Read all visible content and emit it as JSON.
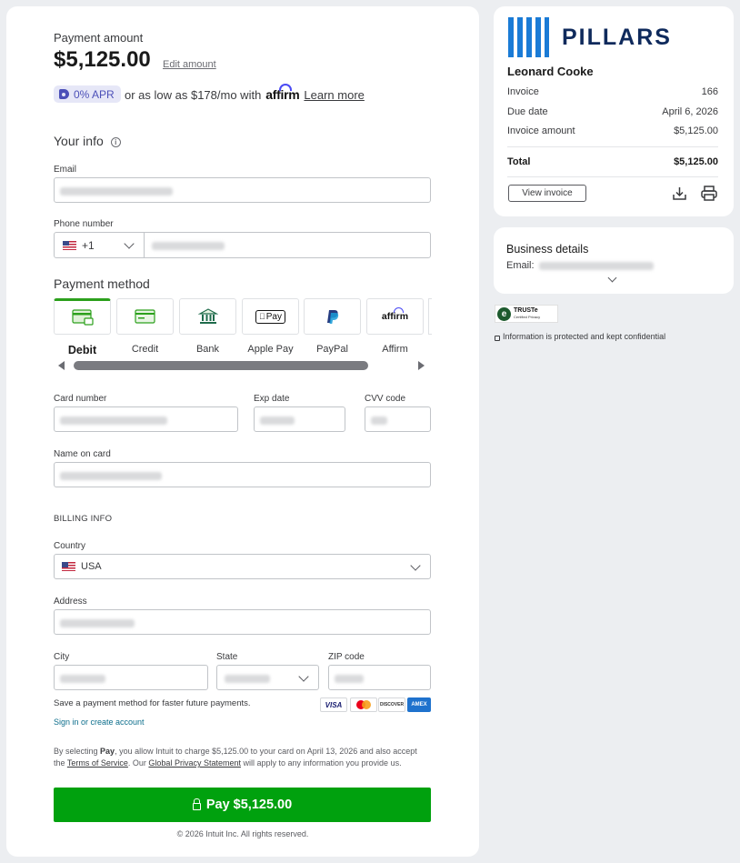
{
  "payment": {
    "label": "Payment amount",
    "amount": "$5,125.00",
    "edit_link": "Edit amount"
  },
  "financing": {
    "apr_badge": "0% APR",
    "text": "or as low as $178/mo with",
    "provider_logo": "affirm",
    "learn_more": "Learn more"
  },
  "your_info": {
    "title": "Your info",
    "email_label": "Email",
    "phone_label": "Phone number",
    "phone_country_code": "+1"
  },
  "payment_method": {
    "title": "Payment method",
    "tabs": [
      {
        "label": "Debit",
        "icon": "debit-card-icon",
        "active": true
      },
      {
        "label": "Credit",
        "icon": "credit-card-icon",
        "active": false
      },
      {
        "label": "Bank",
        "icon": "bank-icon",
        "active": false
      },
      {
        "label": "Apple Pay",
        "icon": "apple-pay-icon",
        "active": false
      },
      {
        "label": "PayPal",
        "icon": "paypal-icon",
        "active": false
      },
      {
        "label": "Affirm",
        "icon": "affirm-icon",
        "active": false
      }
    ],
    "apple_pay_mark": "Pay",
    "affirm_mark": "affirm"
  },
  "card_fields": {
    "card_number_label": "Card number",
    "exp_date_label": "Exp date",
    "cvv_label": "CVV code",
    "name_label": "Name on card"
  },
  "billing": {
    "title": "BILLING INFO",
    "country_label": "Country",
    "country_value": "USA",
    "address_label": "Address",
    "city_label": "City",
    "state_label": "State",
    "zip_label": "ZIP code"
  },
  "save_method_text": "Save a payment method for faster future payments.",
  "card_brands": [
    "VISA",
    "Mastercard",
    "DISCOVER",
    "AMEX"
  ],
  "signin_link": "Sign in or create account",
  "legal": {
    "prefix": "By selecting",
    "pay_word": "Pay",
    "middle": ", you allow Intuit to charge $5,125.00 to your card on April 13, 2026 and also accept the",
    "terms_link": "Terms of Service",
    "our": ". Our",
    "privacy_link": "Global Privacy Statement",
    "suffix": "will apply to any information you provide us."
  },
  "pay_button": "Pay $5,125.00",
  "footer": "© 2026 Intuit Inc. All rights reserved.",
  "invoice": {
    "company_logo": "PILLARS",
    "customer_name": "Leonard Cooke",
    "rows": [
      {
        "label": "Invoice",
        "value": "166"
      },
      {
        "label": "Due date",
        "value": "April 6, 2026"
      },
      {
        "label": "Invoice amount",
        "value": "$5,125.00"
      }
    ],
    "total_label": "Total",
    "total_value": "$5,125.00",
    "view_invoice": "View invoice"
  },
  "business": {
    "title": "Business details",
    "email_label": "Email:"
  },
  "truste": {
    "badge_title": "TRUSTe",
    "badge_sub": "Certified Privacy",
    "security_note": "Information is protected and kept confidential"
  },
  "colors": {
    "pay_button": "#00a10e",
    "active_tab": "#2ca01c",
    "apr_badge_bg": "#e6e7f7",
    "apr_badge_text": "#4c50b8",
    "logo_blue": "#1a7bd6",
    "logo_navy": "#0f2a5c"
  }
}
